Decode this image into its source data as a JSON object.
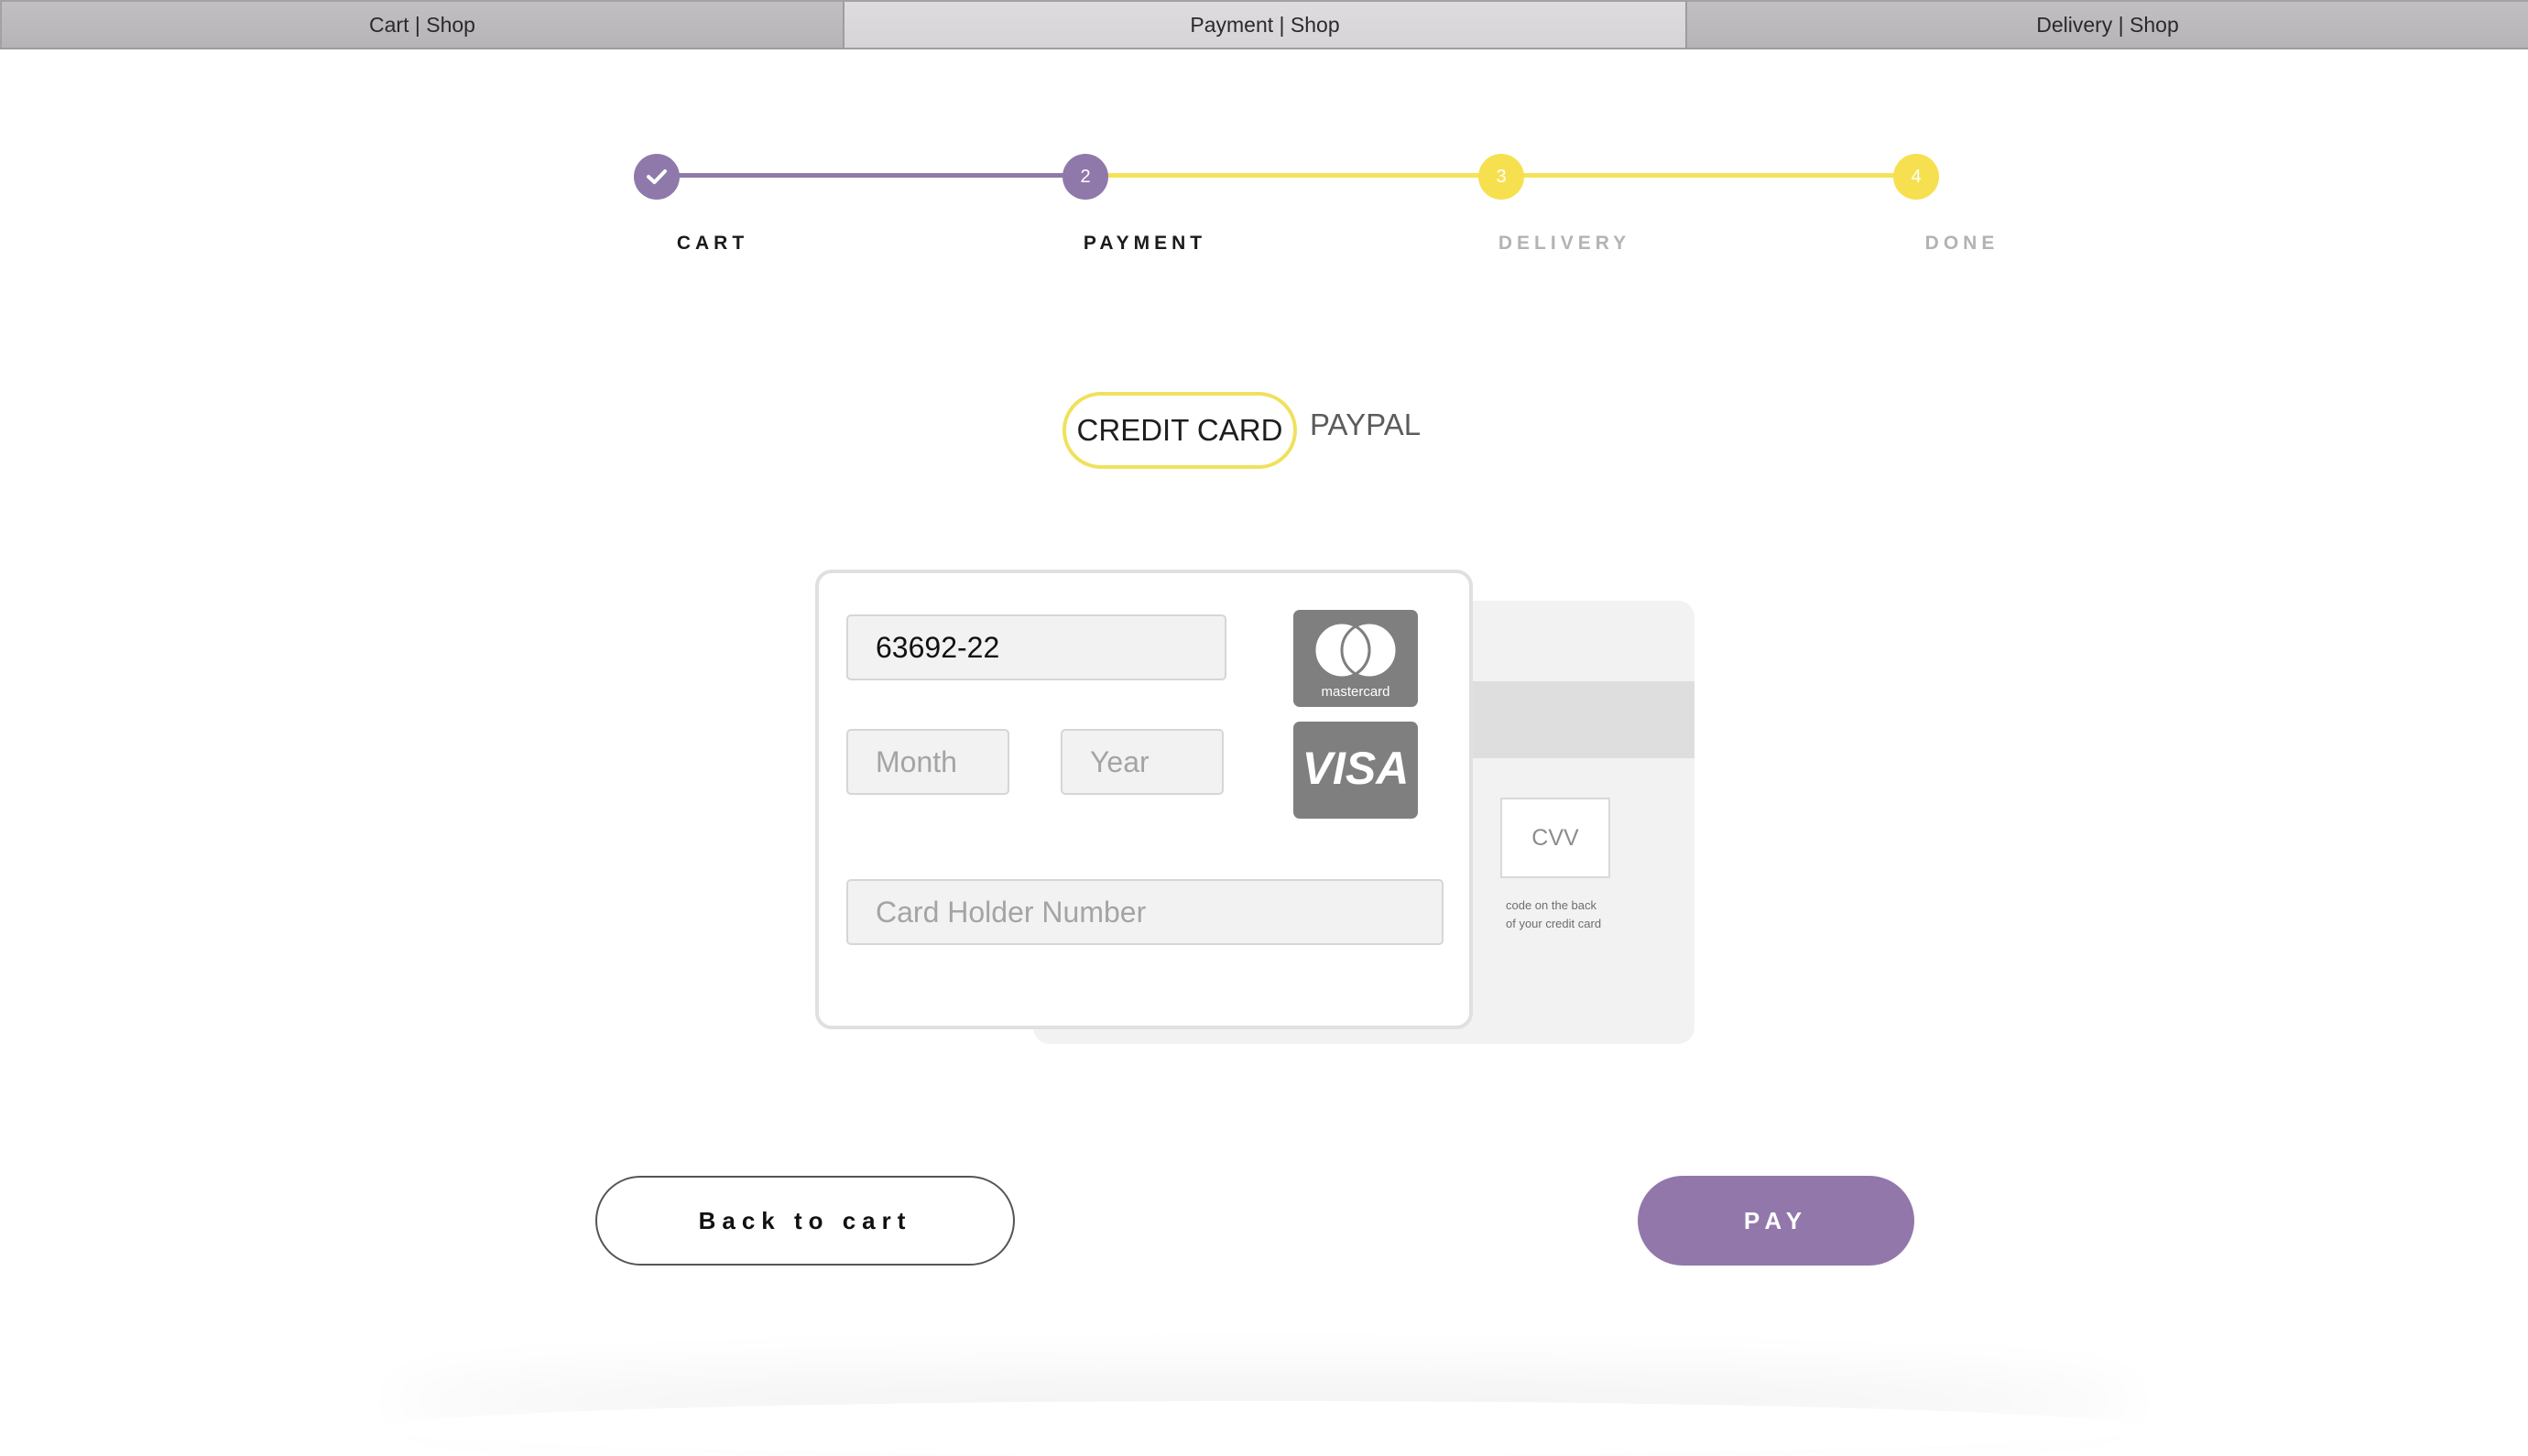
{
  "tabs": [
    {
      "label": "Cart | Shop",
      "active": false
    },
    {
      "label": "Payment | Shop",
      "active": true
    },
    {
      "label": "Delivery | Shop",
      "active": false
    }
  ],
  "stepper": {
    "steps": [
      {
        "number": "",
        "icon": "check-icon",
        "label": "CART",
        "state": "completed"
      },
      {
        "number": "2",
        "label": "PAYMENT",
        "state": "current"
      },
      {
        "number": "3",
        "label": "DELIVERY",
        "state": "upcoming"
      },
      {
        "number": "4",
        "label": "DONE",
        "state": "upcoming"
      }
    ]
  },
  "payment_methods": {
    "credit_card": "CREDIT CARD",
    "paypal": "PAYPAL",
    "selected": "credit_card"
  },
  "card_form": {
    "card_number_value": "63692-22",
    "month_placeholder": "Month",
    "year_placeholder": "Year",
    "holder_placeholder": "Card Holder Number",
    "brands": [
      "mastercard",
      "VISA"
    ],
    "cvv_label": "CVV",
    "cvv_hint": "code on the back of your credit card"
  },
  "actions": {
    "back_label": "Back to cart",
    "pay_label": "PAY"
  },
  "colors": {
    "accent_purple": "#8f79aa",
    "accent_yellow": "#f6e04f",
    "brand_grey": "#7f7f7f"
  }
}
